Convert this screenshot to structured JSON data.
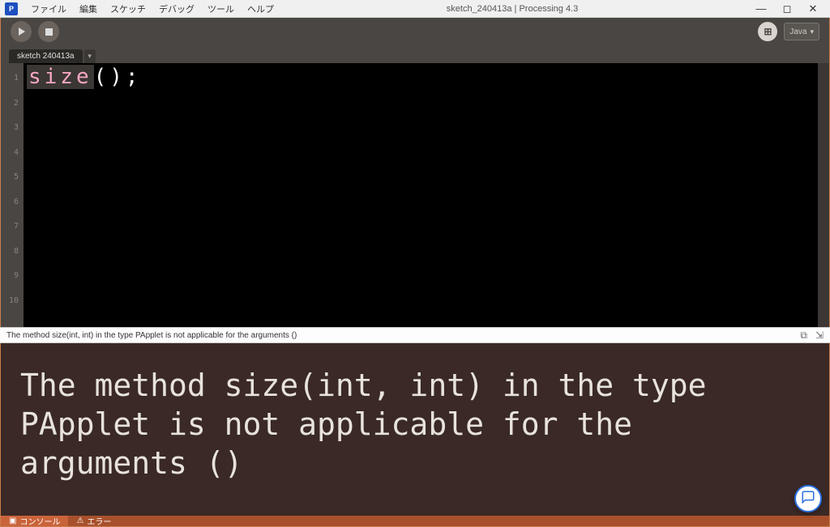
{
  "menubar": {
    "items": [
      "ファイル",
      "編集",
      "スケッチ",
      "デバッグ",
      "ツール",
      "ヘルプ"
    ],
    "title": "sketch_240413a | Processing 4.3"
  },
  "toolbar": {
    "language": "Java"
  },
  "tabs": {
    "active": "sketch 240413a"
  },
  "editor": {
    "gutter_lines": [
      "1",
      "2",
      "3",
      "4",
      "5",
      "6",
      "7",
      "8",
      "9",
      "10"
    ],
    "line1_keyword": "size",
    "line1_rest": "();"
  },
  "status": {
    "message": "The method size(int, int) in the type PApplet is not applicable for the arguments ()"
  },
  "console": {
    "text": "The method size(int, int) in the type PApplet is not applicable for the arguments ()"
  },
  "bottom": {
    "console_label": "コンソール",
    "errors_label": "エラー"
  }
}
